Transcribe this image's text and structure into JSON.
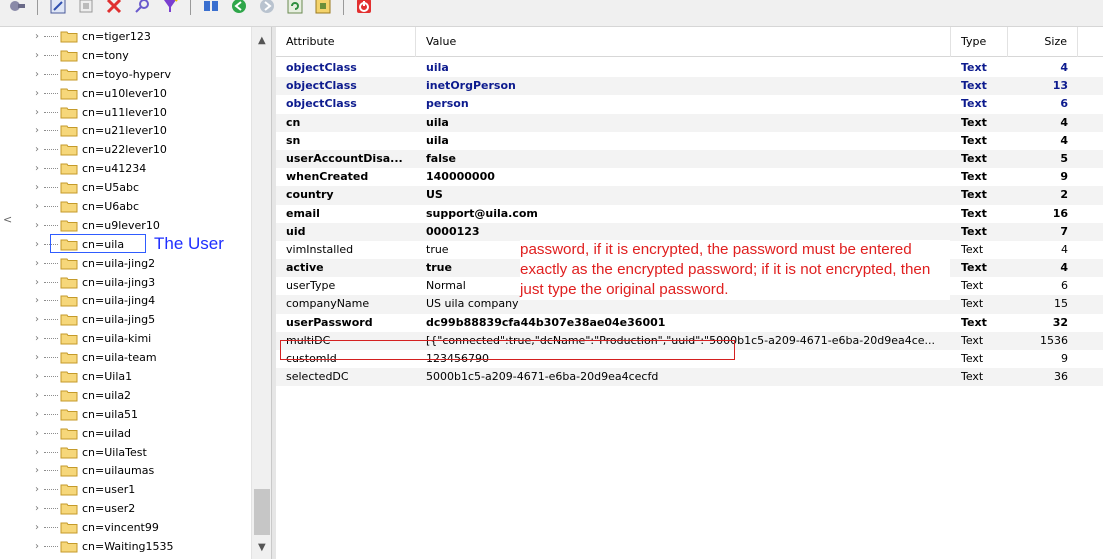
{
  "toolbar": {
    "buttons": [
      "connect-icon",
      "edit-icon",
      "properties-icon",
      "delete-icon",
      "search-icon",
      "filter-icon",
      "book-icon",
      "back-icon",
      "forward-icon",
      "refresh-icon",
      "export-icon",
      "power-icon"
    ]
  },
  "tree": {
    "items": [
      {
        "label": "cn=tiger123"
      },
      {
        "label": "cn=tony"
      },
      {
        "label": "cn=toyo-hyperv"
      },
      {
        "label": "cn=u10lever10"
      },
      {
        "label": "cn=u11lever10"
      },
      {
        "label": "cn=u21lever10"
      },
      {
        "label": "cn=u22lever10"
      },
      {
        "label": "cn=u41234"
      },
      {
        "label": "cn=U5abc"
      },
      {
        "label": "cn=U6abc"
      },
      {
        "label": "cn=u9lever10"
      },
      {
        "label": "cn=uila"
      },
      {
        "label": "cn=uila-jing2"
      },
      {
        "label": "cn=uila-jing3"
      },
      {
        "label": "cn=uila-jing4"
      },
      {
        "label": "cn=uila-jing5"
      },
      {
        "label": "cn=uila-kimi"
      },
      {
        "label": "cn=uila-team"
      },
      {
        "label": "cn=Uila1"
      },
      {
        "label": "cn=uila2"
      },
      {
        "label": "cn=uila51"
      },
      {
        "label": "cn=uilad"
      },
      {
        "label": "cn=UilaTest"
      },
      {
        "label": "cn=uilaumas"
      },
      {
        "label": "cn=user1"
      },
      {
        "label": "cn=user2"
      },
      {
        "label": "cn=vincent99"
      },
      {
        "label": "cn=Waiting1535"
      }
    ],
    "selected_index": 11,
    "annotation": "The User",
    "side_glyph": "<"
  },
  "grid": {
    "headers": {
      "attribute": "Attribute",
      "value": "Value",
      "type": "Type",
      "size": "Size"
    },
    "rows": [
      {
        "attribute": "objectClass",
        "value": "uila",
        "type": "Text",
        "size": "4",
        "style": "blue"
      },
      {
        "attribute": "objectClass",
        "value": "inetOrgPerson",
        "type": "Text",
        "size": "13",
        "style": "blue"
      },
      {
        "attribute": "objectClass",
        "value": "person",
        "type": "Text",
        "size": "6",
        "style": "blue"
      },
      {
        "attribute": "cn",
        "value": "uila",
        "type": "Text",
        "size": "4",
        "style": "bold"
      },
      {
        "attribute": "sn",
        "value": "uila",
        "type": "Text",
        "size": "4",
        "style": "bold"
      },
      {
        "attribute": "userAccountDisa...",
        "value": "false",
        "type": "Text",
        "size": "5",
        "style": "bold"
      },
      {
        "attribute": "whenCreated",
        "value": "140000000",
        "type": "Text",
        "size": "9",
        "style": "bold"
      },
      {
        "attribute": "country",
        "value": "US",
        "type": "Text",
        "size": "2",
        "style": "bold"
      },
      {
        "attribute": "email",
        "value": "support@uila.com",
        "type": "Text",
        "size": "16",
        "style": "bold"
      },
      {
        "attribute": "uid",
        "value": "0000123",
        "type": "Text",
        "size": "7",
        "style": "bold"
      },
      {
        "attribute": "vimInstalled",
        "value": "true",
        "type": "Text",
        "size": "4",
        "style": "normal"
      },
      {
        "attribute": "active",
        "value": "true",
        "type": "Text",
        "size": "4",
        "style": "bold"
      },
      {
        "attribute": "userType",
        "value": "Normal",
        "type": "Text",
        "size": "6",
        "style": "normal"
      },
      {
        "attribute": "companyName",
        "value": "US uila company",
        "type": "Text",
        "size": "15",
        "style": "normal"
      },
      {
        "attribute": "userPassword",
        "value": "dc99b88839cfa44b307e38ae04e36001",
        "type": "Text",
        "size": "32",
        "style": "bold"
      },
      {
        "attribute": "multiDC",
        "value": "[{\"connected\":true,\"dcName\":\"Production\",\"uuid\":\"5000b1c5-a209-4671-e6ba-20d9ea4ce...",
        "type": "Text",
        "size": "1536",
        "style": "normal"
      },
      {
        "attribute": "customId",
        "value": "123456790",
        "type": "Text",
        "size": "9",
        "style": "normal"
      },
      {
        "attribute": "selectedDC",
        "value": "5000b1c5-a209-4671-e6ba-20d9ea4cecfd",
        "type": "Text",
        "size": "36",
        "style": "normal"
      }
    ],
    "note": "password, if it is encrypted, the password must be entered exactly as the encrypted password; if it is not encrypted, then just type the original password."
  }
}
